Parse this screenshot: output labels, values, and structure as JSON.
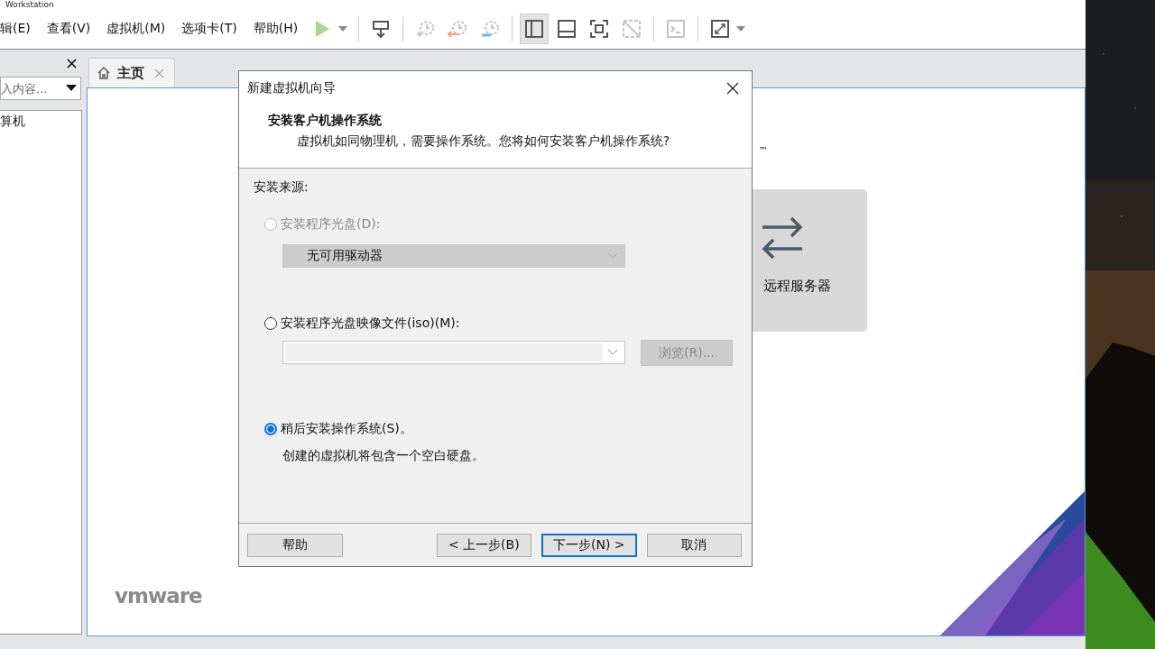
{
  "app_title": "Workstation",
  "menu": [
    "辑(E)",
    "查看(V)",
    "虚拟机(M)",
    "选项卡(T)",
    "帮助(H)"
  ],
  "toolbar": [
    {
      "kind": "play",
      "disabled": true,
      "selected": false,
      "dropdown": true
    },
    {
      "kind": "send-keys",
      "disabled": false,
      "selected": false,
      "dropdown": false
    },
    {
      "kind": "snapshot",
      "disabled": true,
      "selected": false,
      "dropdown": false
    },
    {
      "kind": "revert",
      "disabled": true,
      "selected": false,
      "dropdown": false
    },
    {
      "kind": "snapshot-manager",
      "disabled": true,
      "selected": false,
      "dropdown": false
    },
    {
      "kind": "sidebar",
      "disabled": false,
      "selected": true,
      "dropdown": false
    },
    {
      "kind": "thumbnail-bar",
      "disabled": false,
      "selected": false,
      "dropdown": false
    },
    {
      "kind": "fullscreen",
      "disabled": false,
      "selected": false,
      "dropdown": false
    },
    {
      "kind": "unity",
      "disabled": true,
      "selected": false,
      "dropdown": false
    },
    {
      "kind": "console",
      "disabled": true,
      "selected": false,
      "dropdown": false
    },
    {
      "kind": "stretch",
      "disabled": false,
      "selected": false,
      "dropdown": true
    }
  ],
  "library": {
    "search": {
      "placeholder": "入内容..."
    },
    "items": [
      {
        "label": "算机",
        "selected": false
      }
    ]
  },
  "tabs": [
    {
      "label": "主页",
      "selected": true
    }
  ],
  "home": {
    "logo_mark": "™",
    "cards": [
      {
        "label": "远程服务器"
      }
    ],
    "brand": "vmware"
  },
  "dialog": {
    "title": "新建虚拟机向导",
    "heading": "安装客户机操作系统",
    "subheading": "虚拟机如同物理机，需要操作系统。您将如何安装客户机操作系统?",
    "section_label": "安装来源:",
    "options": [
      {
        "kind": "disc",
        "label": "安装程序光盘(D):",
        "selected": false,
        "disabled": true,
        "dropdown": "无可用驱动器"
      },
      {
        "kind": "iso",
        "label": "安装程序光盘映像文件(iso)(M):",
        "selected": false,
        "disabled": false,
        "browse": {
          "label": "浏览(R)...",
          "disabled": true
        }
      },
      {
        "kind": "later",
        "label": "稍后安装操作系统(S)。",
        "selected": true,
        "disabled": false,
        "note": "创建的虚拟机将包含一个空白硬盘。"
      }
    ],
    "buttons": [
      {
        "label": "帮助",
        "default": false
      },
      {
        "label": "< 上一步(B)",
        "default": false
      },
      {
        "label": "下一步(N) >",
        "default": true
      },
      {
        "label": "取消",
        "default": false
      }
    ]
  }
}
